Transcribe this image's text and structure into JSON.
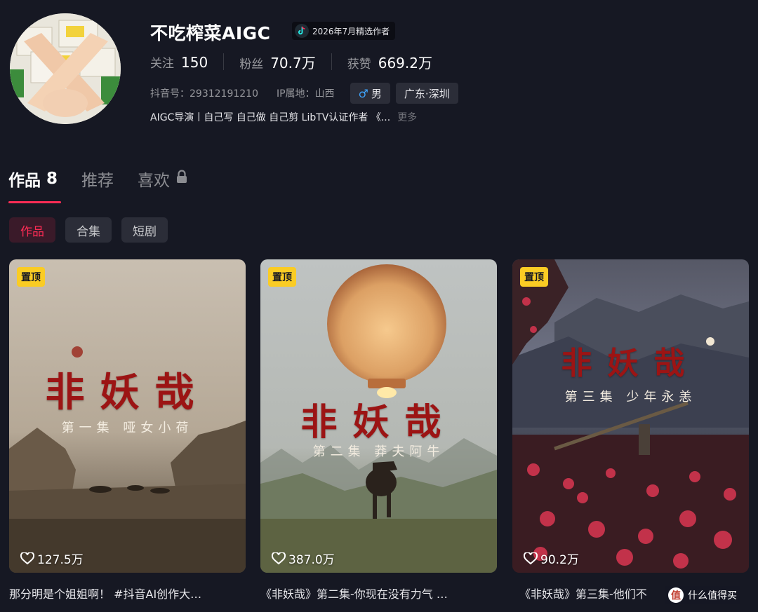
{
  "profile": {
    "name": "不吃榨菜AIGC",
    "badge": "2026年7月精选作者",
    "stats": [
      {
        "label": "关注",
        "value": "150"
      },
      {
        "label": "粉丝",
        "value": "70.7万"
      },
      {
        "label": "获赞",
        "value": "669.2万"
      }
    ],
    "douyin_id": "抖音号：29312191210",
    "ip_location": "IP属地：山西",
    "gender": "男",
    "gender_symbol": "♂",
    "region": "广东·深圳",
    "bio": "AIGC导演丨自己写 自己做 自己剪 LibTV认证作者 《...",
    "bio_more": "更多"
  },
  "tabs": [
    {
      "label": "作品",
      "count": "8"
    },
    {
      "label": "推荐"
    },
    {
      "label": "喜欢"
    }
  ],
  "chips": [
    "作品",
    "合集",
    "短剧"
  ],
  "videos": [
    {
      "pin": "置顶",
      "title": "非妖哉",
      "subtitle": "第一集 哑女小荷",
      "likes": "127.5万",
      "caption": "那分明是个姐姐啊！ #抖音AI创作大…"
    },
    {
      "pin": "置顶",
      "title": "非妖哉",
      "subtitle": "第二集 莽夫阿牛",
      "likes": "387.0万",
      "caption": "《非妖哉》第二集-你现在没有力气 …"
    },
    {
      "pin": "置顶",
      "title": "非妖哉",
      "subtitle": "第三集 少年永恙",
      "likes": "90.2万",
      "caption": "《非妖哉》第三集-他们不"
    }
  ],
  "watermark": {
    "icon": "值",
    "text": "什么值得买"
  },
  "colors": {
    "background": "#161823",
    "accent": "#fe2c55",
    "pin": "#facc24",
    "title_red": "#9c1414"
  }
}
